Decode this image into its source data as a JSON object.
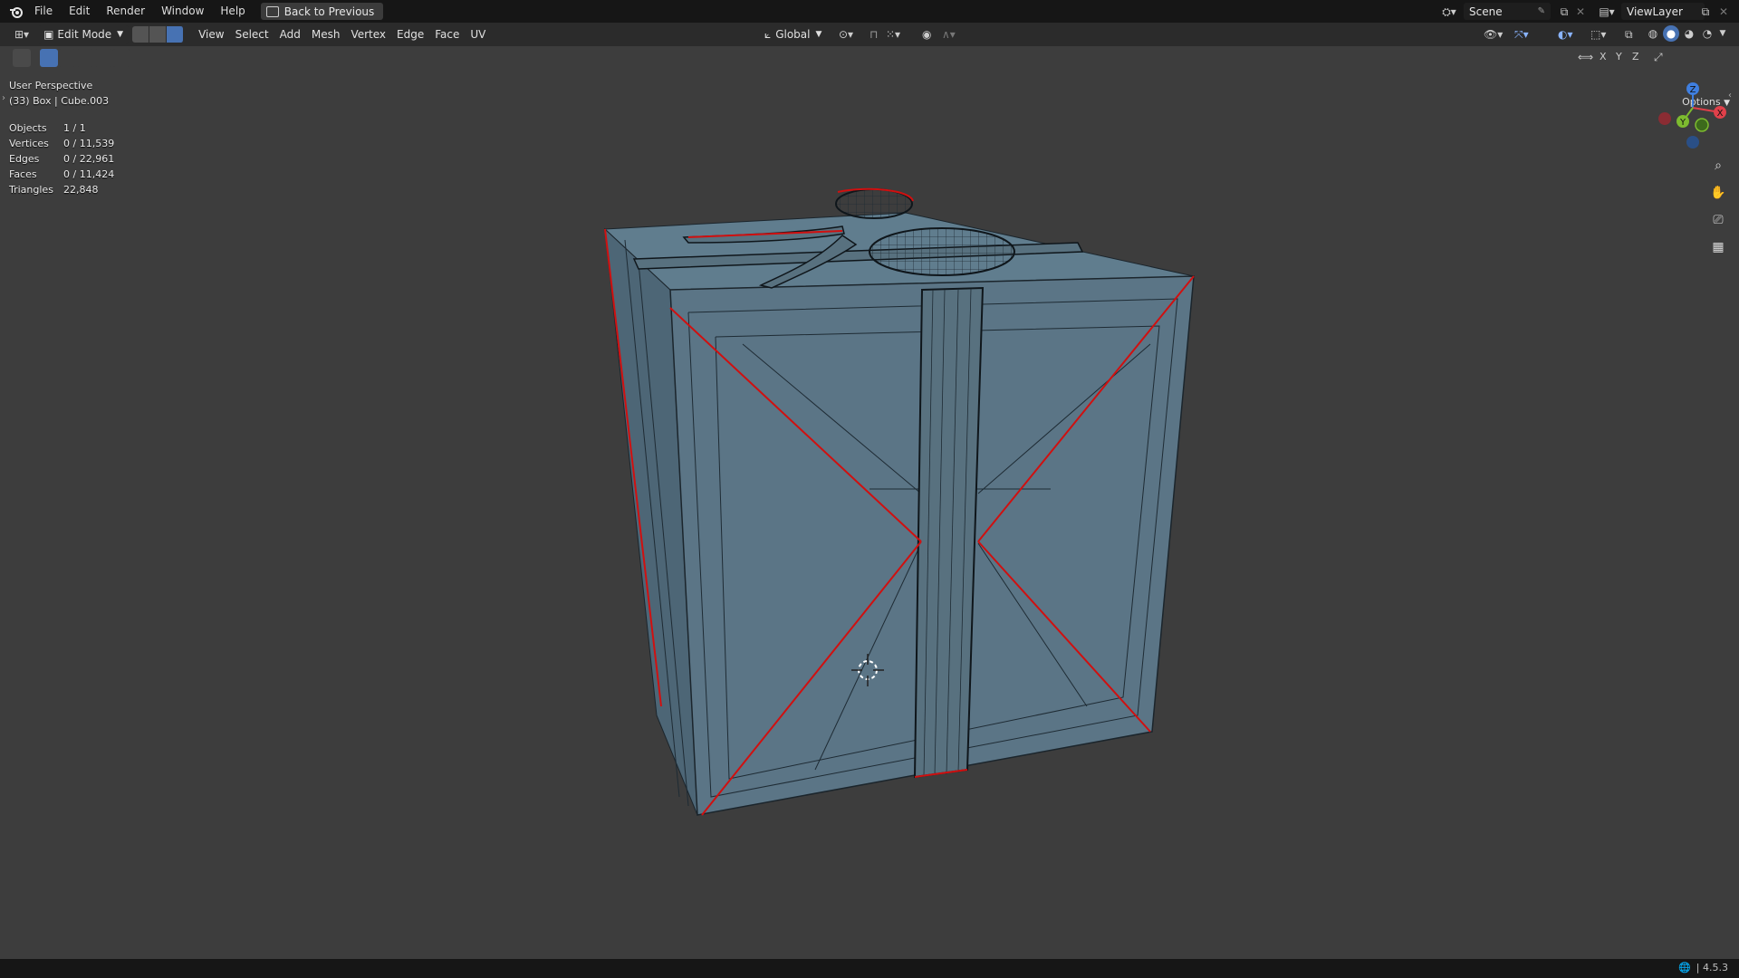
{
  "menubar": {
    "items": [
      "File",
      "Edit",
      "Render",
      "Window",
      "Help"
    ],
    "back_label": "Back to Previous",
    "scene_label": "Scene",
    "viewlayer_label": "ViewLayer"
  },
  "header": {
    "mode_label": "Edit Mode",
    "menus": [
      "View",
      "Select",
      "Add",
      "Mesh",
      "Vertex",
      "Edge",
      "Face",
      "UV"
    ],
    "orientation_label": "Global",
    "options_label": "Options",
    "axis_x": "X",
    "axis_y": "Y",
    "axis_z": "Z"
  },
  "overlay": {
    "view_name": "User Perspective",
    "object_info": "(33) Box | Cube.003"
  },
  "stats": {
    "objects_label": "Objects",
    "objects_value": "1 / 1",
    "vertices_label": "Vertices",
    "vertices_value": "0 / 11,539",
    "edges_label": "Edges",
    "edges_value": "0 / 22,961",
    "faces_label": "Faces",
    "faces_value": "0 / 11,424",
    "triangles_label": "Triangles",
    "triangles_value": "22,848"
  },
  "gizmo": {
    "x": "X",
    "y": "Y",
    "z": "Z"
  },
  "status": {
    "version": "4.5.3"
  },
  "colors": {
    "accent": "#4772b3",
    "seam": "#d01010",
    "mesh_fill": "#5a7485",
    "background": "#3d3d3d"
  }
}
